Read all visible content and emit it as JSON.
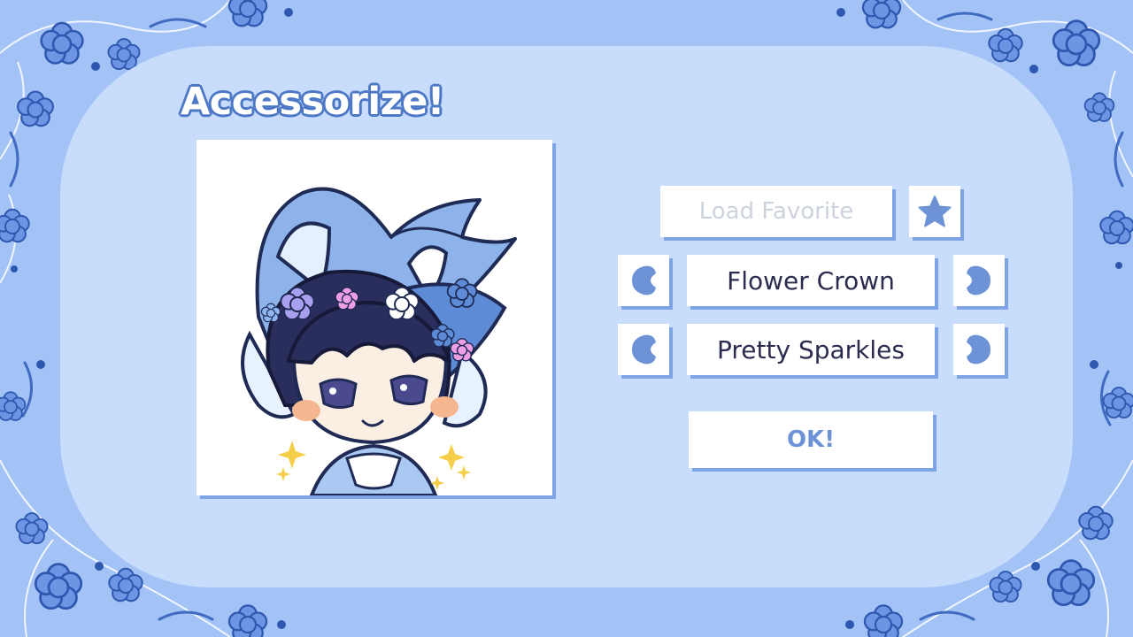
{
  "screen": {
    "title": "Accessorize!",
    "load_favorite_label": "Load Favorite",
    "favorite_icon": "star-icon",
    "options": [
      {
        "value": "Flower Crown"
      },
      {
        "value": "Pretty Sparkles"
      }
    ],
    "ok_label": "OK!"
  },
  "colors": {
    "background": "#a3c2f6",
    "panel": "#c8dcfb",
    "accent": "#6d92d6",
    "title_outline": "#4d78c5",
    "button_shadow": "#7fa4e3",
    "text_dark": "#2b2c4e",
    "text_disabled": "#cdd3dc"
  }
}
